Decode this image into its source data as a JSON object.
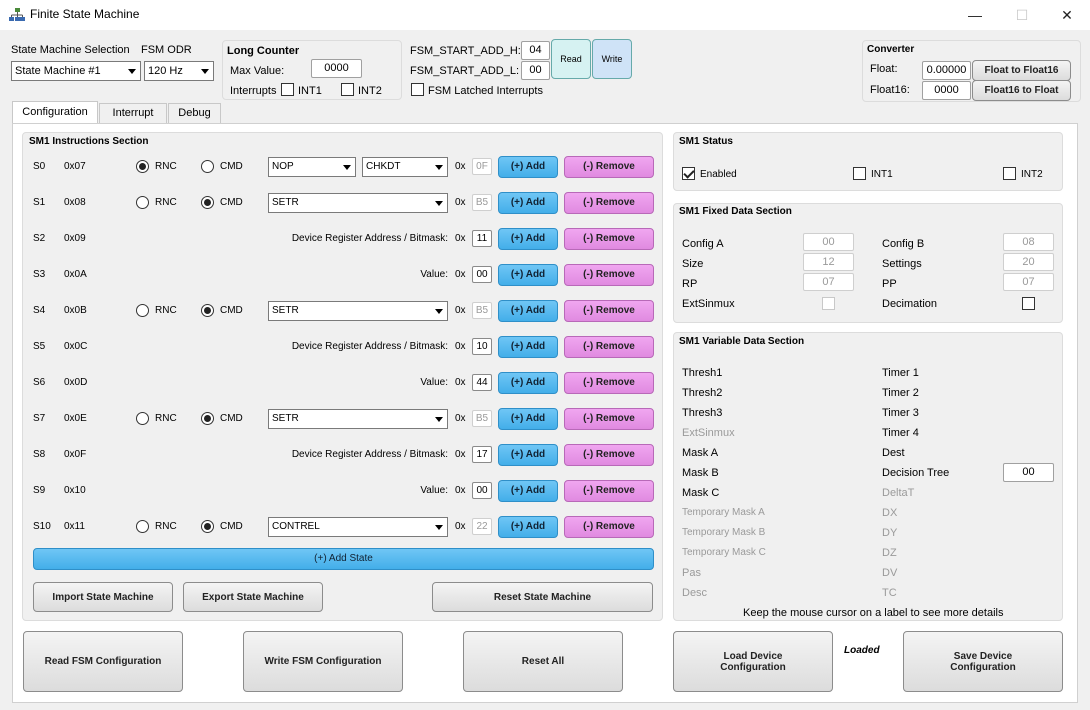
{
  "window": {
    "title": "Finite State Machine",
    "minimize": "—",
    "maximize": "☐",
    "close": "✕"
  },
  "top": {
    "sm_selection_label": "State Machine Selection",
    "sm_selection_value": "State Machine #1",
    "odr_label": "FSM ODR",
    "odr_value": "120 Hz",
    "long_counter": {
      "title": "Long Counter",
      "max_value_label": "Max Value:",
      "max_value": "0000",
      "interrupts_label": "Interrupts",
      "int1": "INT1",
      "int2": "INT2"
    },
    "start_add_h_label": "FSM_START_ADD_H:",
    "start_add_h": "04",
    "start_add_l_label": "FSM_START_ADD_L:",
    "start_add_l": "00",
    "read_label": "Read",
    "write_label": "Write",
    "latched_label": "FSM Latched Interrupts",
    "converter": {
      "title": "Converter",
      "float_label": "Float:",
      "float_value": "0.00000",
      "float_btn": "Float to Float16",
      "float16_label": "Float16:",
      "float16_value": "0000",
      "float16_btn": "Float16 to Float"
    }
  },
  "tabs": [
    "Configuration",
    "Interrupt",
    "Debug"
  ],
  "instructions": {
    "title": "SM1 Instructions Section",
    "hex_prefix": "0x",
    "add_label": "(+) Add",
    "remove_label": "(-) Remove",
    "add_state_label": "(+) Add State",
    "rows": [
      {
        "state": "S0",
        "addr": "0x07",
        "type": "select",
        "rnc_label": "RNC",
        "cmd_label": "CMD",
        "rnc": true,
        "combo": "NOP",
        "combo2": "CHKDT",
        "hex": "0F",
        "hex_disabled": true
      },
      {
        "state": "S1",
        "addr": "0x08",
        "type": "select",
        "rnc_label": "RNC",
        "cmd_label": "CMD",
        "rnc": false,
        "combo": "SETR",
        "hex": "B5",
        "hex_disabled": true
      },
      {
        "state": "S2",
        "addr": "0x09",
        "type": "param",
        "param_label": "Device Register Address / Bitmask:",
        "hex": "11",
        "hex_disabled": false
      },
      {
        "state": "S3",
        "addr": "0x0A",
        "type": "param",
        "param_label": "Value:",
        "hex": "00",
        "hex_disabled": false
      },
      {
        "state": "S4",
        "addr": "0x0B",
        "type": "select",
        "rnc_label": "RNC",
        "cmd_label": "CMD",
        "rnc": false,
        "combo": "SETR",
        "hex": "B5",
        "hex_disabled": true
      },
      {
        "state": "S5",
        "addr": "0x0C",
        "type": "param",
        "param_label": "Device Register Address / Bitmask:",
        "hex": "10",
        "hex_disabled": false
      },
      {
        "state": "S6",
        "addr": "0x0D",
        "type": "param",
        "param_label": "Value:",
        "hex": "44",
        "hex_disabled": false
      },
      {
        "state": "S7",
        "addr": "0x0E",
        "type": "select",
        "rnc_label": "RNC",
        "cmd_label": "CMD",
        "rnc": false,
        "combo": "SETR",
        "hex": "B5",
        "hex_disabled": true
      },
      {
        "state": "S8",
        "addr": "0x0F",
        "type": "param",
        "param_label": "Device Register Address / Bitmask:",
        "hex": "17",
        "hex_disabled": false
      },
      {
        "state": "S9",
        "addr": "0x10",
        "type": "param",
        "param_label": "Value:",
        "hex": "00",
        "hex_disabled": false
      },
      {
        "state": "S10",
        "addr": "0x11",
        "type": "select",
        "rnc_label": "RNC",
        "cmd_label": "CMD",
        "rnc": false,
        "combo": "CONTREL",
        "hex": "22",
        "hex_disabled": true
      }
    ],
    "import_btn": "Import State Machine",
    "export_btn": "Export State Machine",
    "reset_btn": "Reset State Machine"
  },
  "status": {
    "title": "SM1 Status",
    "enabled": "Enabled",
    "int1": "INT1",
    "int2": "INT2"
  },
  "fixed": {
    "title": "SM1 Fixed Data Section",
    "left": [
      {
        "label": "Config A",
        "value": "00"
      },
      {
        "label": "Size",
        "value": "12"
      },
      {
        "label": "RP",
        "value": "07"
      },
      {
        "label": "ExtSinmux",
        "value": ""
      }
    ],
    "right": [
      {
        "label": "Config B",
        "value": "08"
      },
      {
        "label": "Settings",
        "value": "20"
      },
      {
        "label": "PP",
        "value": "07"
      },
      {
        "label": "Decimation",
        "value": ""
      }
    ]
  },
  "variable": {
    "title": "SM1 Variable Data Section",
    "left": [
      "Thresh1",
      "Thresh2",
      "Thresh3",
      "ExtSinmux",
      "Mask A",
      "Mask B",
      "Mask C",
      "Temporary Mask A",
      "Temporary Mask B",
      "Temporary Mask C",
      "Pas",
      "Desc"
    ],
    "right": [
      "Timer 1",
      "Timer 2",
      "Timer 3",
      "Timer 4",
      "Dest",
      "Decision Tree",
      "DeltaT",
      "DX",
      "DY",
      "DZ",
      "DV",
      "TC"
    ],
    "decision_tree_value": "00",
    "hint": "Keep the mouse cursor on a label to see more details"
  },
  "bottom": {
    "read_btn": "Read FSM Configuration",
    "write_btn": "Write FSM Configuration",
    "reset_btn": "Reset All",
    "load_btn": "Load Device Configuration",
    "loaded_label": "Loaded",
    "save_btn": "Save Device Configuration"
  }
}
